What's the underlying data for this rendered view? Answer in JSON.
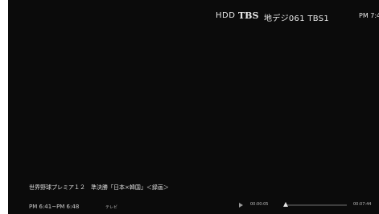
{
  "header": {
    "storage": "HDD",
    "channel_logo": "TBS",
    "channel_info": "地デジ061 TBS1",
    "clock": "PM 7:4"
  },
  "program": {
    "title": "世界野球プレミア１２　準決勝「日本×韓国」＜録画＞",
    "time_range": "PM 6:41~PM 6:48",
    "genre": "テレビ"
  },
  "playback": {
    "elapsed": "00:00:05",
    "total": "00:07:44",
    "progress": 0.011
  }
}
